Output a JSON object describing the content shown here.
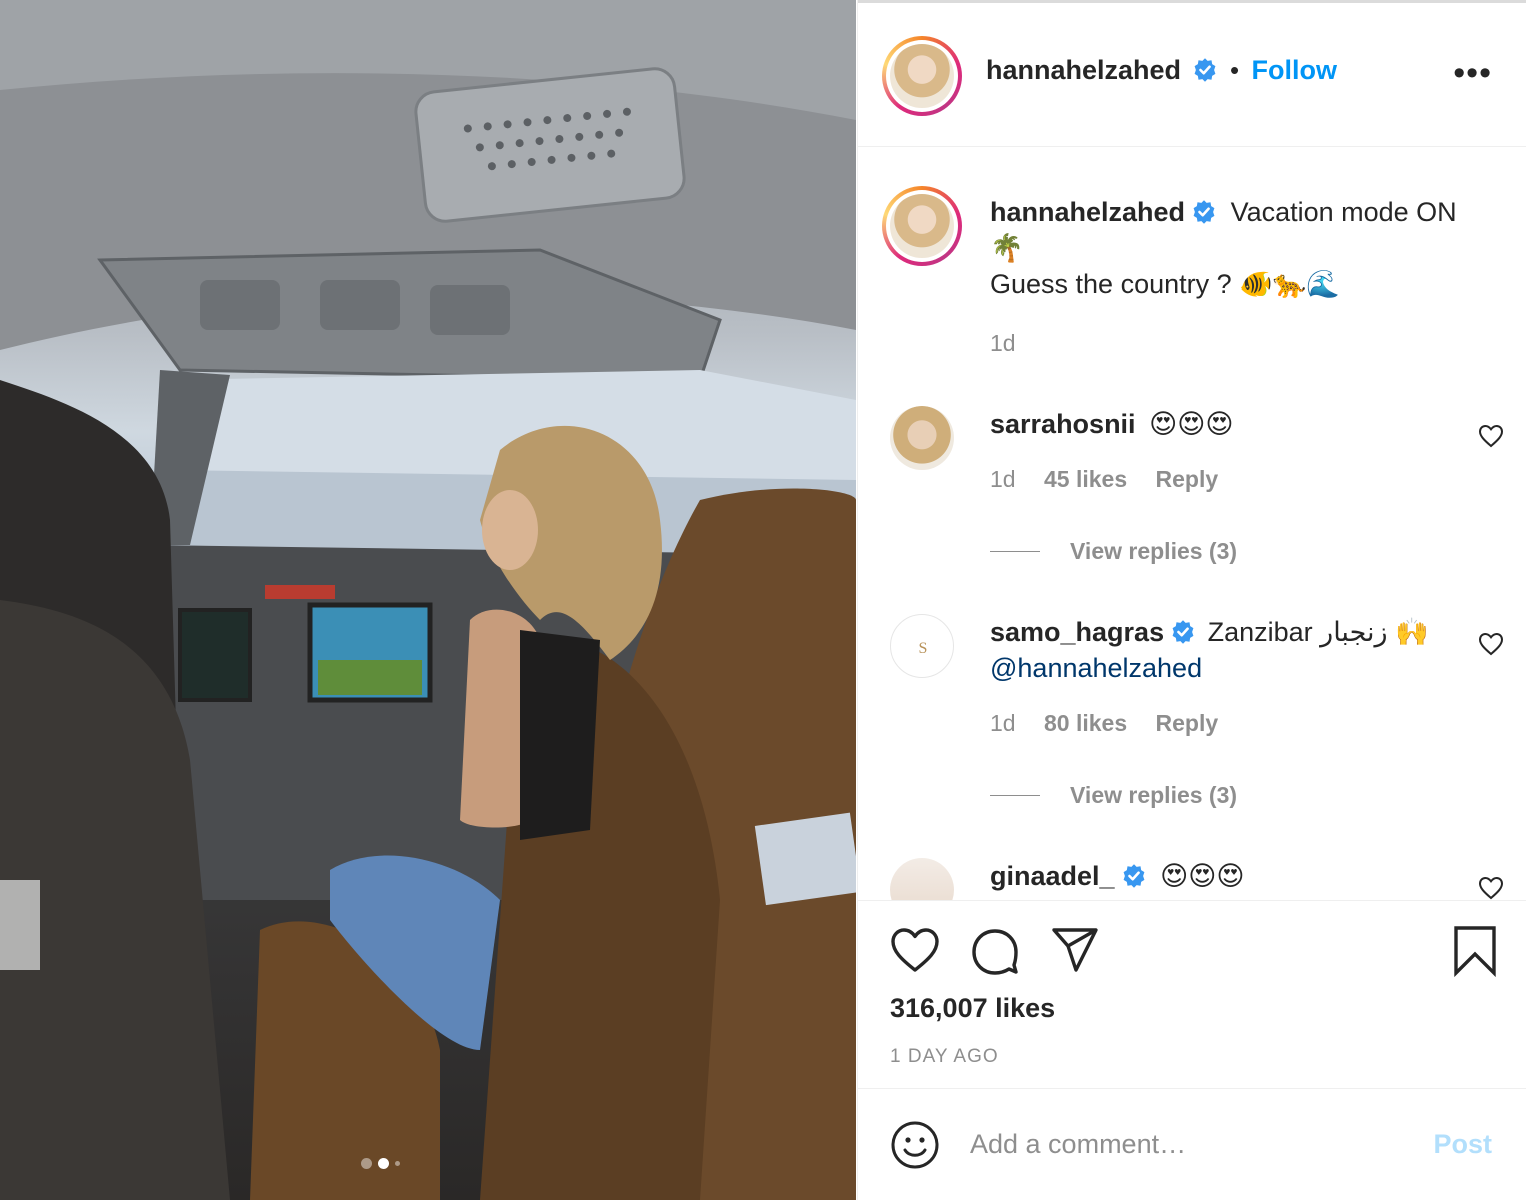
{
  "post": {
    "username": "hannahelzahed",
    "follow_label": "Follow",
    "separator": "•",
    "more_label": "•••",
    "carousel": {
      "count": 3,
      "active_index": 1
    }
  },
  "caption": {
    "username": "hannahelzahed",
    "text_line1": "Vacation mode ON",
    "emoji_line1": "🌴",
    "text_line2": "Guess the country ?",
    "emoji_line2": "🐠🐆🌊",
    "time": "1d"
  },
  "comments": [
    {
      "username": "sarrahosnii",
      "text": "😍😍😍",
      "time": "1d",
      "likes": "45 likes",
      "reply_label": "Reply",
      "view_replies": "View replies (3)"
    },
    {
      "username": "samo_hagras",
      "text": "Zanzibar زنجبار 🙌",
      "mention": "@hannahelzahed",
      "time": "1d",
      "likes": "80 likes",
      "reply_label": "Reply",
      "view_replies": "View replies (3)"
    },
    {
      "username": "ginaadel_",
      "text": "😍😍😍"
    }
  ],
  "actions": {
    "likes_count": "316,007 likes",
    "posted_ago": "1 DAY AGO"
  },
  "add_comment": {
    "placeholder": "Add a comment…",
    "post_label": "Post"
  },
  "colors": {
    "accent": "#0095f6",
    "verified": "#3897f0",
    "muted": "#8e8e8e",
    "post_disabled": "#b2dffc"
  }
}
